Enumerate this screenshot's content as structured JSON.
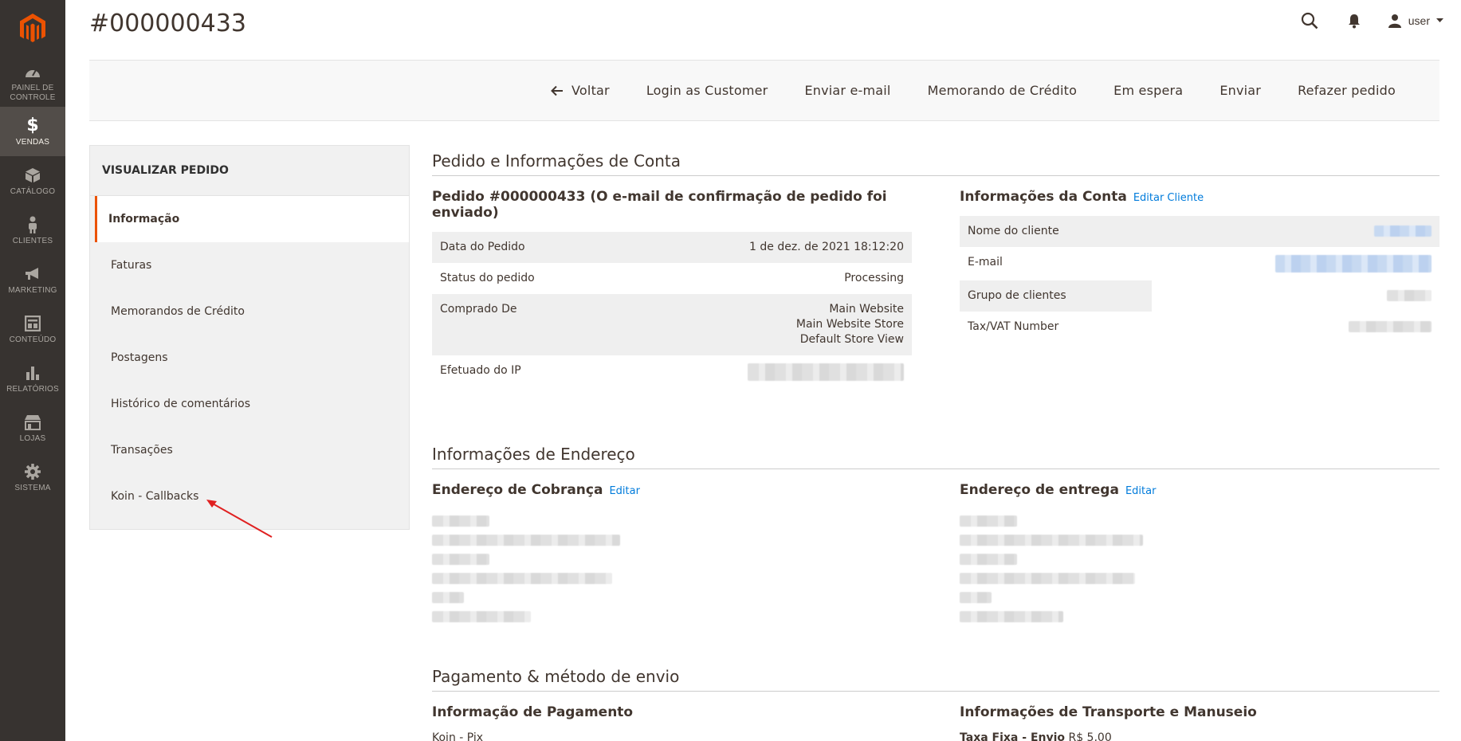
{
  "nav": {
    "items": [
      {
        "label": "PAINEL DE CONTROLE",
        "icon": "dashboard-icon"
      },
      {
        "label": "VENDAS",
        "icon": "dollar-icon",
        "active": true
      },
      {
        "label": "CATÁLOGO",
        "icon": "box-icon"
      },
      {
        "label": "CLIENTES",
        "icon": "person-icon"
      },
      {
        "label": "MARKETING",
        "icon": "megaphone-icon"
      },
      {
        "label": "CONTEÚDO",
        "icon": "layout-icon"
      },
      {
        "label": "RELATÓRIOS",
        "icon": "bar-chart-icon"
      },
      {
        "label": "LOJAS",
        "icon": "store-icon"
      },
      {
        "label": "SISTEMA",
        "icon": "gear-icon"
      }
    ]
  },
  "header": {
    "title": "#000000433",
    "user": "user"
  },
  "toolbar": {
    "back": "Voltar",
    "login_as_customer": "Login as Customer",
    "send_email": "Enviar e-mail",
    "credit_memo": "Memorando de Crédito",
    "hold": "Em espera",
    "ship": "Enviar",
    "reorder": "Refazer pedido"
  },
  "tabs": {
    "title": "VISUALIZAR PEDIDO",
    "items": [
      "Informação",
      "Faturas",
      "Memorandos de Crédito",
      "Postagens",
      "Histórico de comentários",
      "Transações",
      "Koin - Callbacks"
    ]
  },
  "order_account": {
    "section_title": "Pedido e Informações de Conta",
    "order_heading": "Pedido #000000433 (O e-mail de confirmação de pedido foi enviado)",
    "rows": {
      "date_label": "Data do Pedido",
      "date_value": "1 de dez. de 2021 18:12:20",
      "status_label": "Status do pedido",
      "status_value": "Processing",
      "purchased_label": "Comprado De",
      "purchased_1": "Main Website",
      "purchased_2": "Main Website Store",
      "purchased_3": "Default Store View",
      "ip_label": "Efetuado do IP"
    },
    "account_heading": "Informações da Conta",
    "edit_customer": "Editar Cliente",
    "account_rows": {
      "name_label": "Nome do cliente",
      "email_label": "E-mail",
      "group_label": "Grupo de clientes",
      "tax_label": "Tax/VAT Number"
    }
  },
  "address": {
    "section_title": "Informações de Endereço",
    "billing_heading": "Endereço de Cobrança",
    "shipping_heading": "Endereço de entrega",
    "edit": "Editar"
  },
  "payment": {
    "section_title": "Pagamento & método de envio",
    "payment_heading": "Informação de Pagamento",
    "payment_method": "Koin - Pix",
    "shipping_heading": "Informações de Transporte e Manuseio",
    "shipping_method": "Taxa Fixa - Envio",
    "shipping_price": "R$ 5,00"
  },
  "colors": {
    "nav_bg": "#373330",
    "accent": "#eb5202",
    "link": "#007bdb"
  }
}
